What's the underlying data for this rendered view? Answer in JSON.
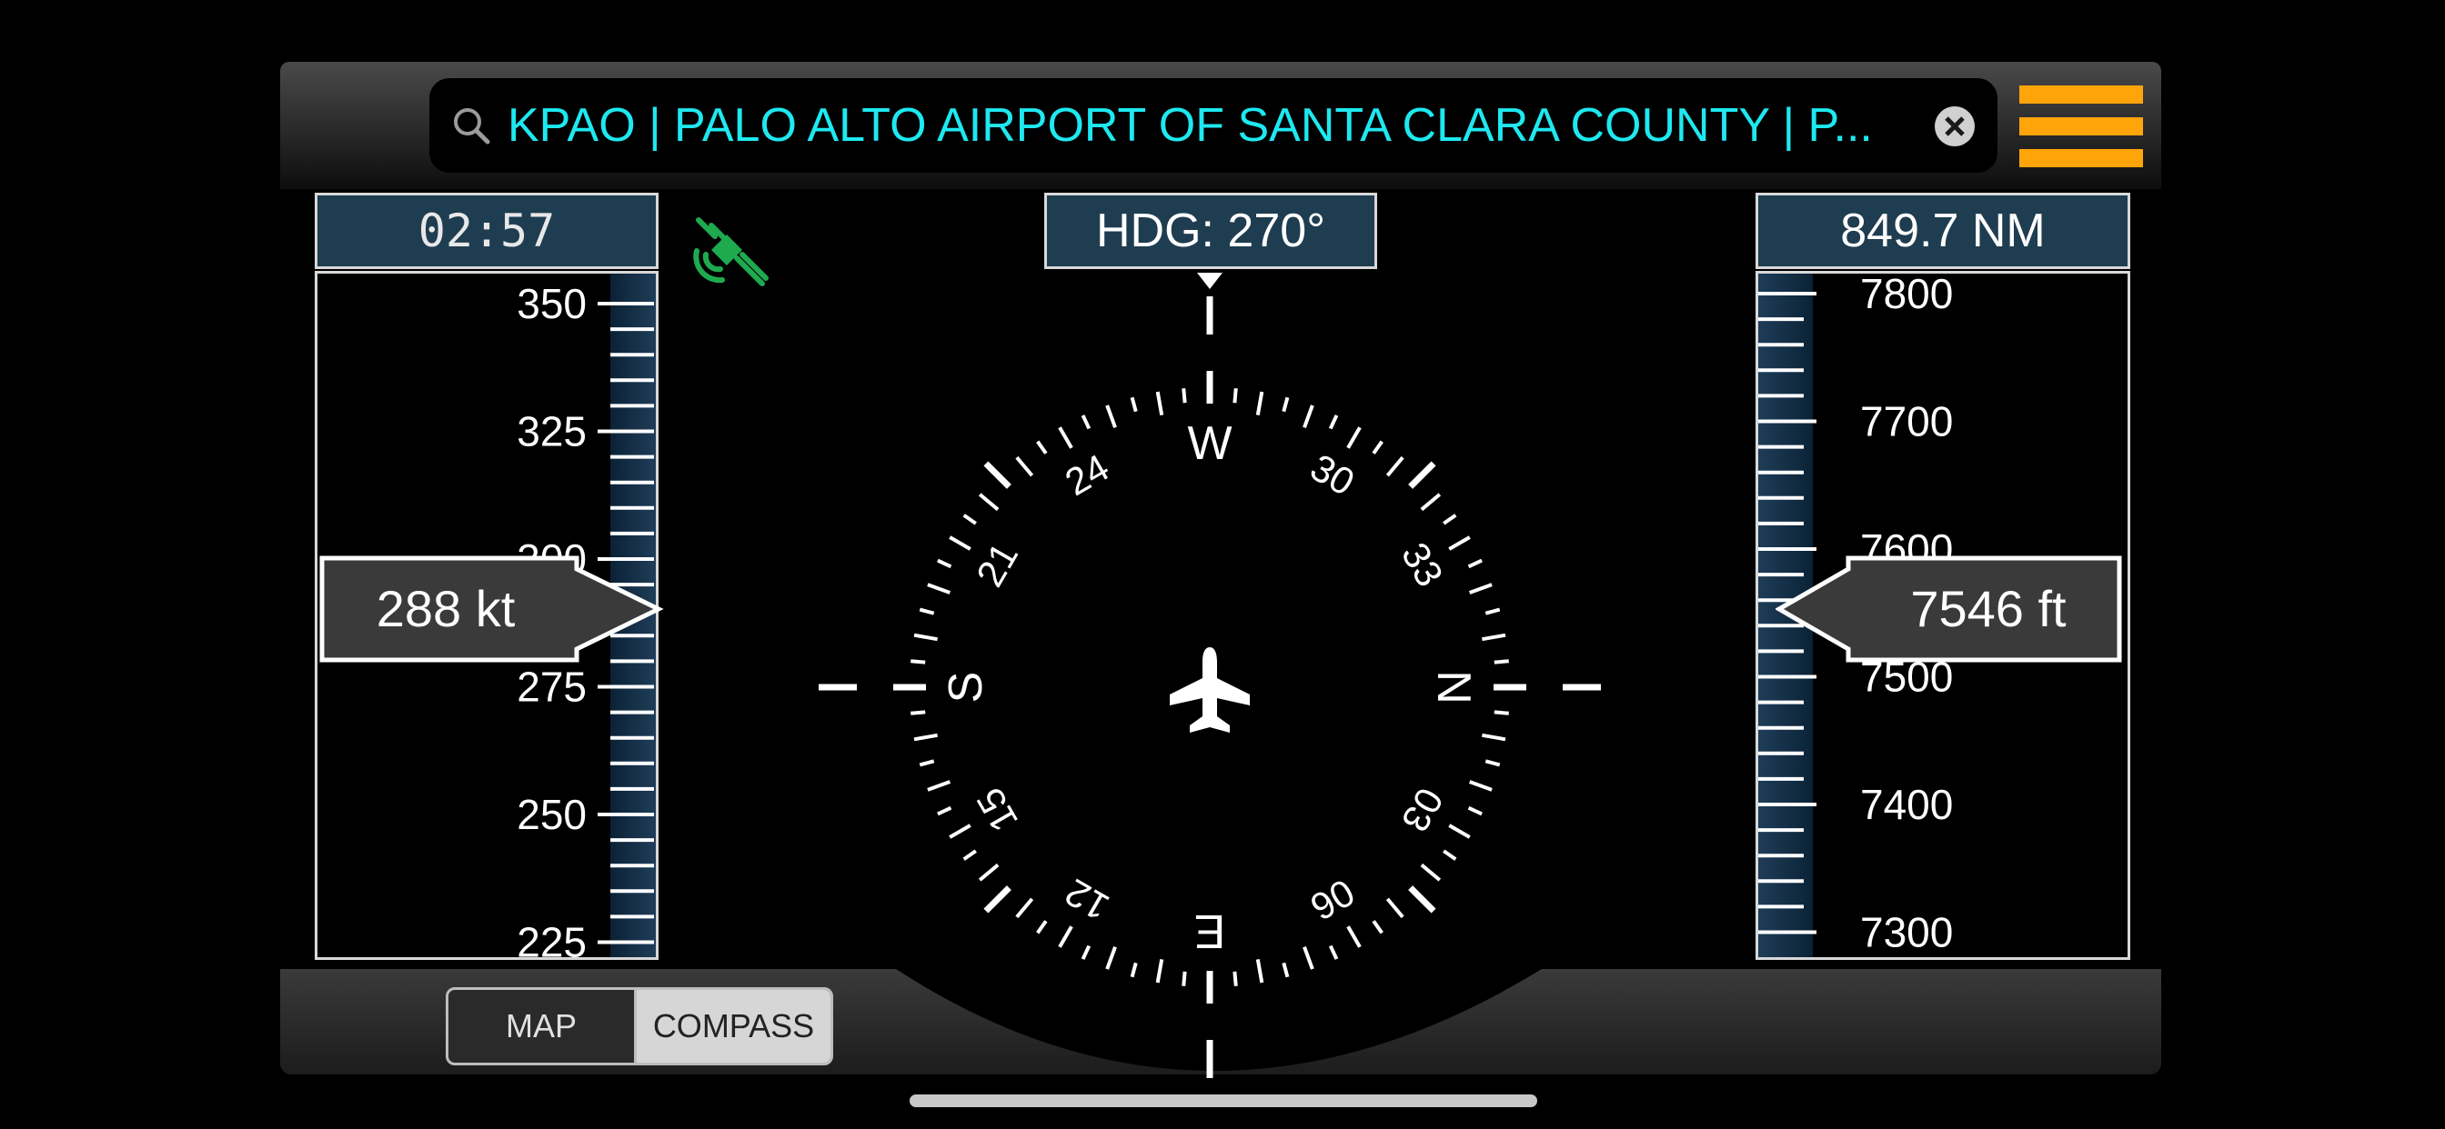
{
  "search": {
    "value": "KPAO | PALO ALTO AIRPORT OF SANTA CLARA COUNTY | P...",
    "icon": "search-icon",
    "clear_icon": "clear-icon"
  },
  "menu": {
    "icon": "hamburger-menu-icon",
    "color": "#ffa50a"
  },
  "timer": "02:57",
  "gps": {
    "icon": "satellite-gps-icon",
    "color": "#1faa50"
  },
  "heading": {
    "label": "HDG: 270°",
    "value_deg": 270
  },
  "distance": "849.7 NM",
  "speed_tape": {
    "labels": [
      "350",
      "325",
      "300",
      "275",
      "250",
      "225"
    ],
    "current": "288 kt"
  },
  "altitude_tape": {
    "labels": [
      "7800",
      "7700",
      "7600",
      "7500",
      "7400",
      "7300"
    ],
    "current": "7546 ft"
  },
  "compass": {
    "labels": [
      "N",
      "03",
      "06",
      "E",
      "12",
      "15",
      "S",
      "21",
      "24",
      "W",
      "30",
      "33"
    ],
    "aircraft_icon": "airplane-icon"
  },
  "view_toggle": {
    "options": [
      "MAP",
      "COMPASS"
    ],
    "selected": "COMPASS"
  },
  "colors": {
    "accent_cyan": "#1ee8f0",
    "panel_blue": "#1f3d50"
  }
}
